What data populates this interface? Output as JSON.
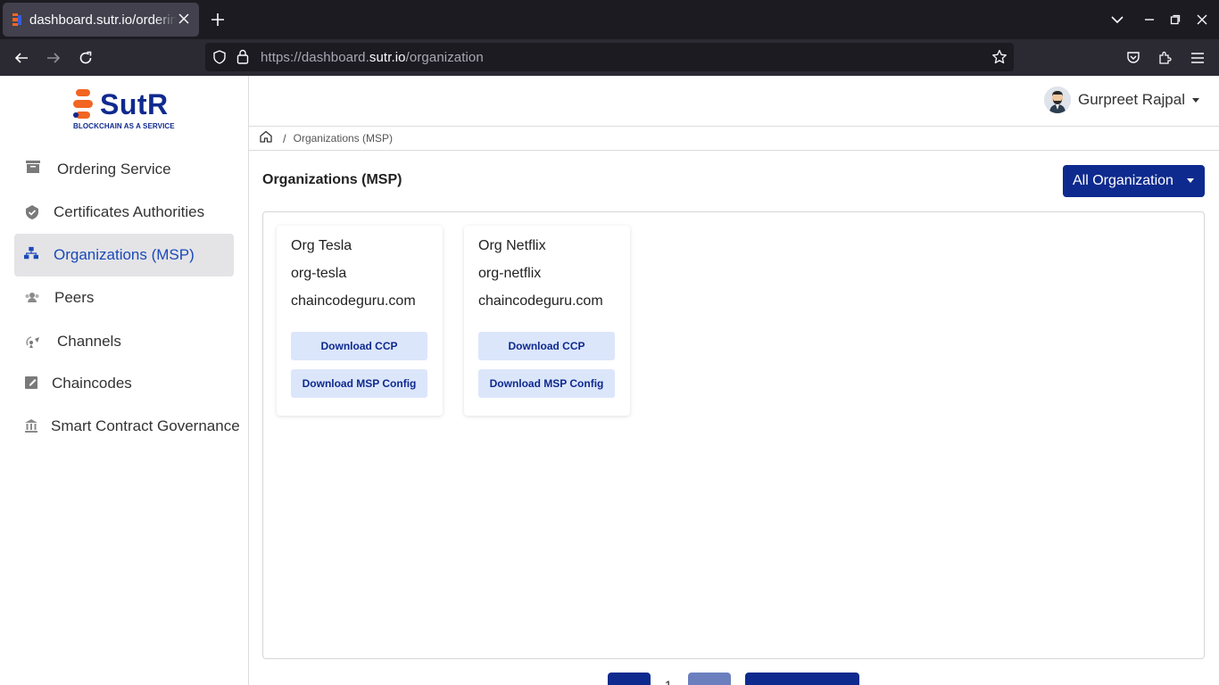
{
  "browser": {
    "tab_title": "dashboard.sutr.io/ordering",
    "url_prefix": "https://dashboard.",
    "url_host": "sutr.io",
    "url_path": "/organization"
  },
  "brand": {
    "name": "SutR",
    "tagline": "BLOCKCHAIN AS A SERVICE",
    "primary_color": "#0e2a8e",
    "accent_color": "#f26522"
  },
  "sidebar": {
    "items": [
      {
        "label": "Ordering Service",
        "icon": "archive-icon",
        "active": false
      },
      {
        "label": "Certificates Authorities",
        "icon": "shield-check-icon",
        "active": false
      },
      {
        "label": "Organizations (MSP)",
        "icon": "sitemap-icon",
        "active": true
      },
      {
        "label": "Peers",
        "icon": "users-icon",
        "active": false
      },
      {
        "label": "Channels",
        "icon": "broadcast-icon",
        "active": false
      },
      {
        "label": "Chaincodes",
        "icon": "edit-note-icon",
        "active": false
      },
      {
        "label": "Smart Contract Governance",
        "icon": "bank-icon",
        "active": false
      }
    ]
  },
  "user": {
    "name": "Gurpreet Rajpal"
  },
  "breadcrumb": {
    "separator": "/",
    "current": "Organizations (MSP)"
  },
  "main": {
    "title": "Organizations (MSP)",
    "filter_label": "All Organization",
    "orgs": [
      {
        "name": "Org Tesla",
        "id": "org-tesla",
        "domain": "chaincodeguru.com",
        "ccp_label": "Download CCP",
        "msp_label": "Download MSP Config"
      },
      {
        "name": "Org Netflix",
        "id": "org-netflix",
        "domain": "chaincodeguru.com",
        "ccp_label": "Download CCP",
        "msp_label": "Download MSP Config"
      }
    ]
  },
  "pagination": {
    "current_page": "1"
  }
}
